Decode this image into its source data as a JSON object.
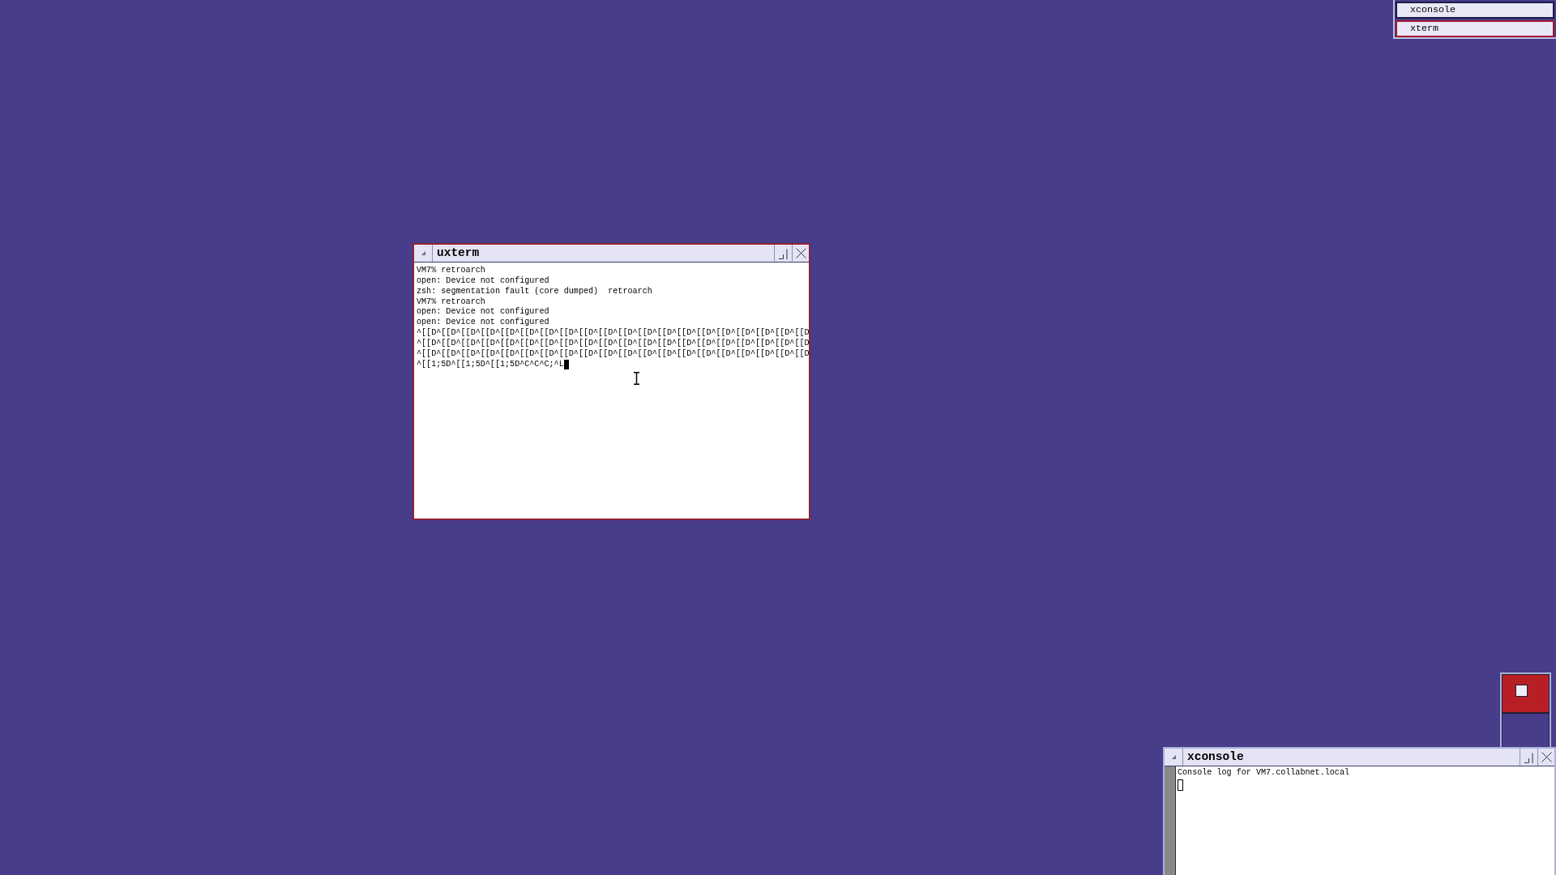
{
  "icon_manager": {
    "items": [
      {
        "label": "xconsole",
        "selected": false
      },
      {
        "label": "xterm",
        "selected": true
      }
    ]
  },
  "windows": [
    {
      "kind": "terminal",
      "title": "uxterm",
      "focused": true,
      "lines": [
        "VM7% retroarch",
        "open: Device not configured",
        "zsh: segmentation fault (core dumped)  retroarch",
        "VM7% retroarch",
        "open: Device not configured",
        "open: Device not configured",
        "^[[D^[[D^[[D^[[D^[[D^[[D^[[D^[[D^[[D^[[D^[[D^[[D^[[D^[[D^[[D^[[D^[[D^[[D^[[D^[[D",
        "^[[D^[[D^[[D^[[D^[[D^[[D^[[D^[[D^[[D^[[D^[[D^[[D^[[D^[[D^[[D^[[D^[[D^[[D^[[D^[[D",
        "^[[D^[[D^[[D^[[D^[[D^[[D^[[D^[[D^[[D^[[D^[[D^[[D^[[D^[[D^[[D^[[D^[[D^[[D^[[D^[[D",
        "^[[1;5D^[[1;5D^[[1;5D^C^C^C;^L"
      ]
    },
    {
      "kind": "console",
      "title": "xconsole",
      "focused": false,
      "lines": [
        "Console log for VM7.collabnet.local"
      ]
    }
  ]
}
